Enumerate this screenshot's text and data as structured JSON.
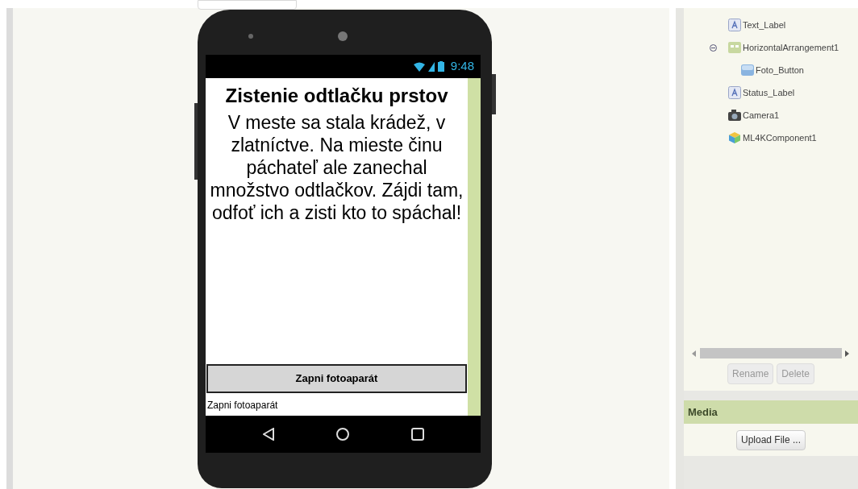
{
  "phone": {
    "status_bar": {
      "time": "9:48"
    },
    "screen": {
      "title": "Zistenie odtlačku prstov",
      "story": "V meste sa stala krádež, v zlatníctve. Na mieste činu páchateľ ale zanechal množstvo odtlačkov. Zájdi tam, odfoť ich a zisti kto to spáchal!",
      "button": "Zapni fotoaparát",
      "status_label": "Zapni fotoaparát"
    }
  },
  "components": {
    "tree": [
      {
        "name": "Text_Label",
        "kind": "label"
      },
      {
        "name": "HorizontalArrangement1",
        "kind": "arrangement",
        "expanded": true,
        "children": [
          {
            "name": "Foto_Button",
            "kind": "button"
          }
        ]
      },
      {
        "name": "Status_Label",
        "kind": "label"
      },
      {
        "name": "Camera1",
        "kind": "camera"
      },
      {
        "name": "ML4KComponent1",
        "kind": "extension"
      }
    ],
    "buttons": [
      {
        "label": "Rename",
        "disabled": true
      },
      {
        "label": "Delete",
        "disabled": true
      }
    ]
  },
  "media": {
    "title": "Media",
    "button": "Upload File ..."
  }
}
